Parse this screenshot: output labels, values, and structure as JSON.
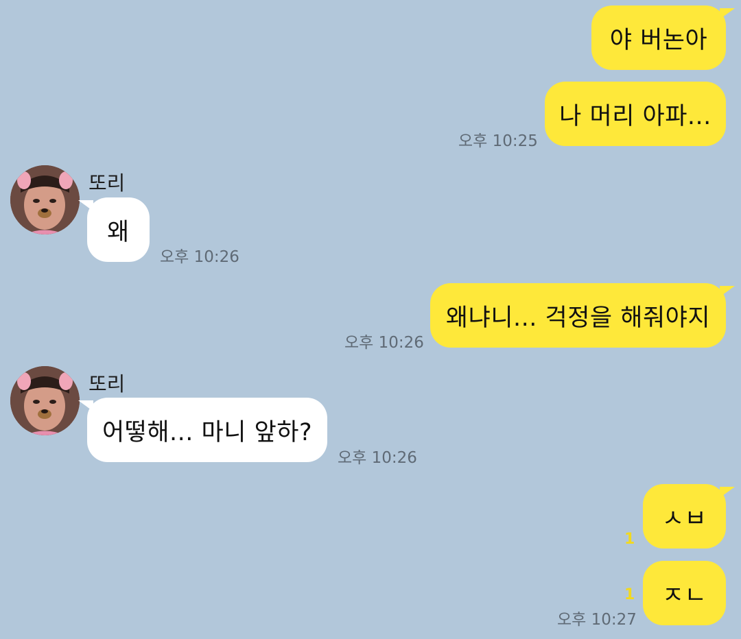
{
  "messages": [
    {
      "side": "out",
      "text": "야 버논아"
    },
    {
      "side": "out",
      "text": "나 머리 아파..."
    },
    {
      "side": "out_time",
      "text": "오후 10:25"
    },
    {
      "side": "in",
      "sender": "또리",
      "text": "왜",
      "time": "오후 10:26"
    },
    {
      "side": "out",
      "text": "왜냐니... 걱정을 해줘야지",
      "time": "오후 10:26"
    },
    {
      "side": "in",
      "sender": "또리",
      "text": "어떻해... 마니 앞하?",
      "time": "오후 10:26"
    },
    {
      "side": "out",
      "text": "ㅅㅂ",
      "unread": "1"
    },
    {
      "side": "out",
      "text": "ㅈㄴ",
      "unread": "1",
      "time": "오후 10:27"
    }
  ],
  "icons": {
    "avatar": "profile-photo-with-dog-filter"
  },
  "colors": {
    "background": "#b2c7da",
    "outgoing_bubble": "#fee83a",
    "incoming_bubble": "#ffffff",
    "unread_count": "#f2d91f"
  }
}
